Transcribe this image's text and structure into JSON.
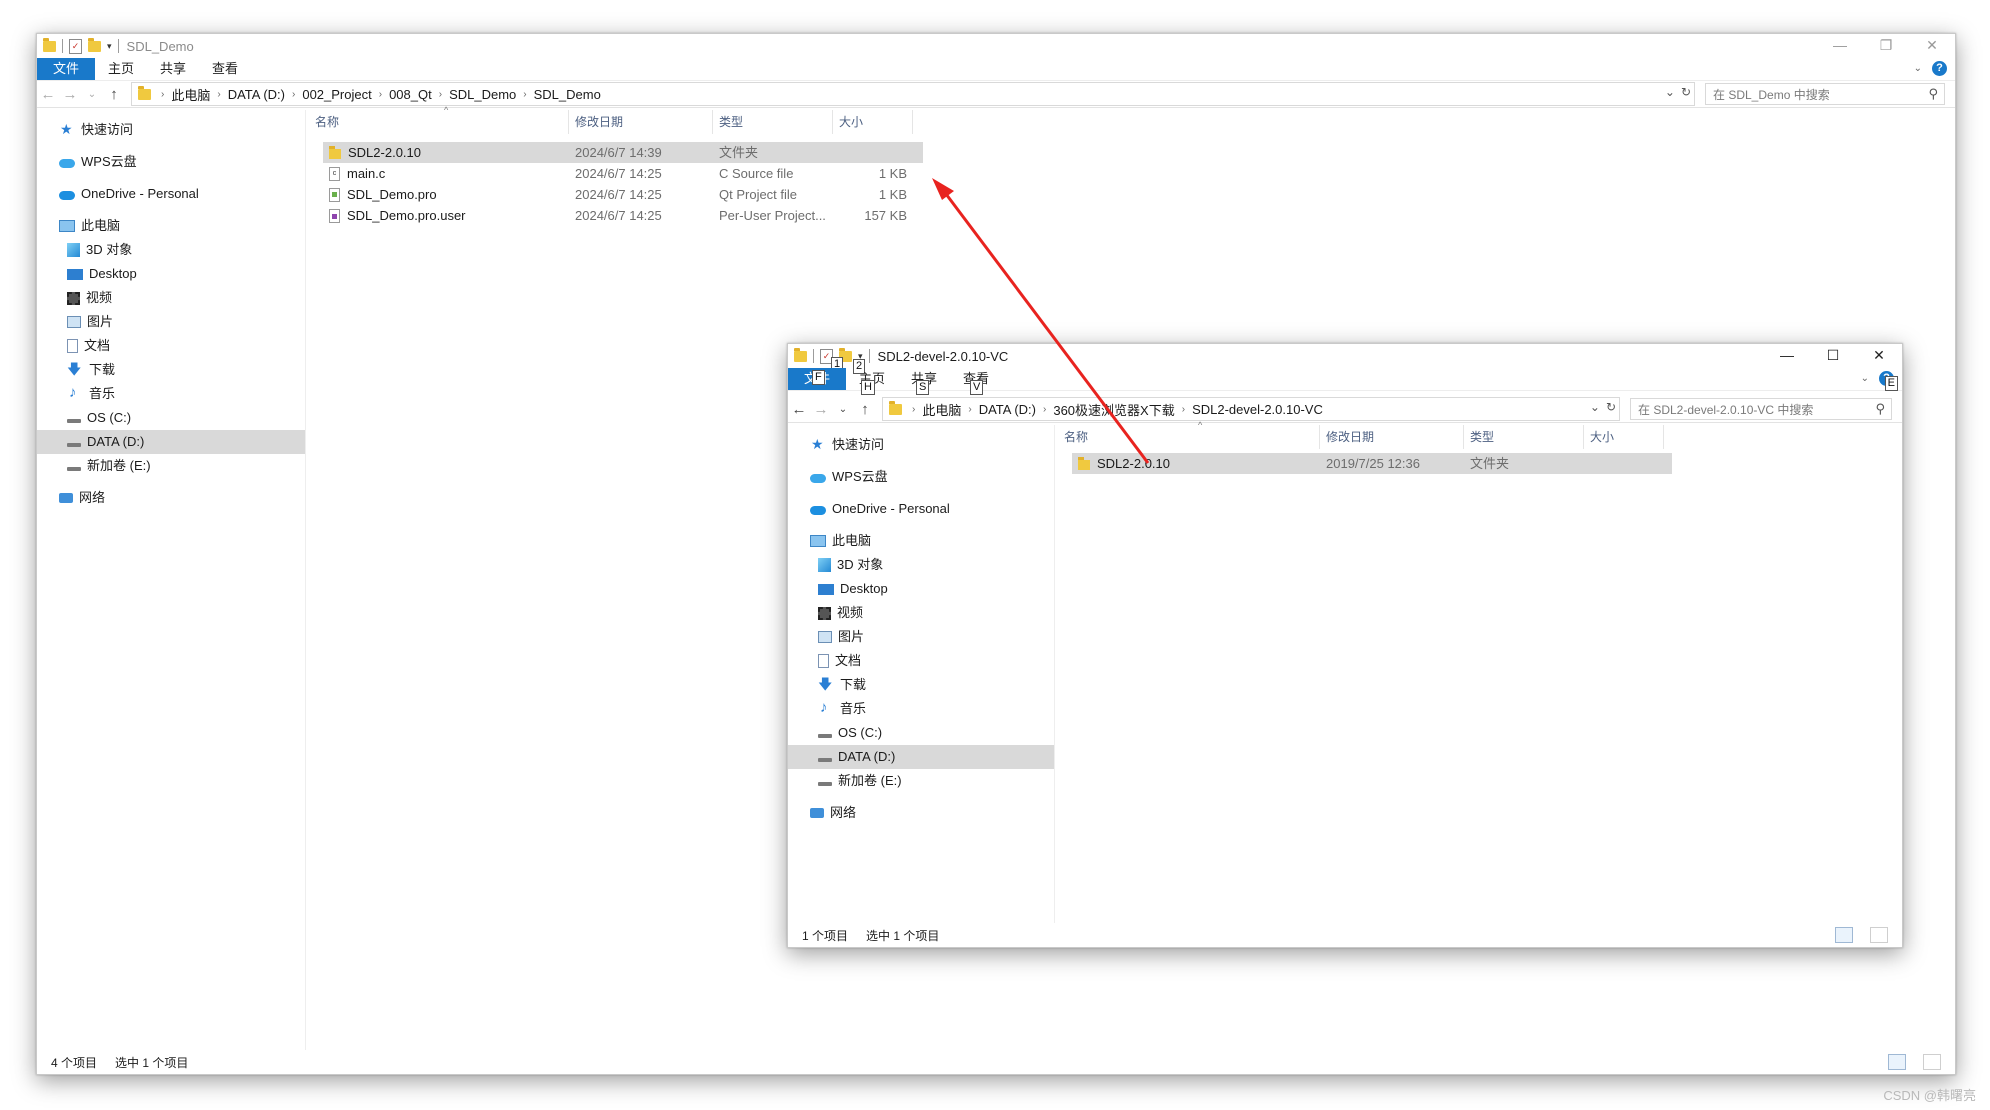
{
  "main_window": {
    "title": "SDL_Demo",
    "tabs": {
      "file": "文件",
      "home": "主页",
      "share": "共享",
      "view": "查看"
    },
    "breadcrumb": [
      "此电脑",
      "DATA (D:)",
      "002_Project",
      "008_Qt",
      "SDL_Demo",
      "SDL_Demo"
    ],
    "search_placeholder": "在 SDL_Demo 中搜索",
    "nav": {
      "quick_access": "快速访问",
      "wps": "WPS云盘",
      "onedrive": "OneDrive - Personal",
      "this_pc": "此电脑",
      "objects3d": "3D 对象",
      "desktop": "Desktop",
      "videos": "视频",
      "pictures": "图片",
      "documents": "文档",
      "downloads": "下载",
      "music": "音乐",
      "drive_c": "OS (C:)",
      "drive_d": "DATA (D:)",
      "drive_e": "新加卷 (E:)",
      "network": "网络"
    },
    "columns": {
      "name": "名称",
      "date": "修改日期",
      "type": "类型",
      "size": "大小"
    },
    "files": [
      {
        "name": "SDL2-2.0.10",
        "date": "2024/6/7 14:39",
        "type": "文件夹",
        "size": "",
        "icon": "folder-icon"
      },
      {
        "name": "main.c",
        "date": "2024/6/7 14:25",
        "type": "C Source file",
        "size": "1 KB",
        "icon": "c-source-file-icon"
      },
      {
        "name": "SDL_Demo.pro",
        "date": "2024/6/7 14:25",
        "type": "Qt Project file",
        "size": "1 KB",
        "icon": "qt-project-file-icon"
      },
      {
        "name": "SDL_Demo.pro.user",
        "date": "2024/6/7 14:25",
        "type": "Per-User Project...",
        "size": "157 KB",
        "icon": "user-project-file-icon"
      }
    ],
    "status": {
      "count": "4 个项目",
      "selected": "选中 1 个项目"
    }
  },
  "sub_window": {
    "title": "SDL2-devel-2.0.10-VC",
    "tabs": {
      "file": "文件",
      "home": "主页",
      "share": "共享",
      "view": "查看"
    },
    "keytips": {
      "qat1": "1",
      "qat2": "2",
      "file": "F",
      "home": "H",
      "share": "S",
      "view": "V",
      "help": "E"
    },
    "breadcrumb": [
      "此电脑",
      "DATA (D:)",
      "360极速浏览器X下载",
      "SDL2-devel-2.0.10-VC"
    ],
    "search_placeholder": "在 SDL2-devel-2.0.10-VC 中搜索",
    "nav": {
      "quick_access": "快速访问",
      "wps": "WPS云盘",
      "onedrive": "OneDrive - Personal",
      "this_pc": "此电脑",
      "objects3d": "3D 对象",
      "desktop": "Desktop",
      "videos": "视频",
      "pictures": "图片",
      "documents": "文档",
      "downloads": "下载",
      "music": "音乐",
      "drive_c": "OS (C:)",
      "drive_d": "DATA (D:)",
      "drive_e": "新加卷 (E:)",
      "network": "网络"
    },
    "columns": {
      "name": "名称",
      "date": "修改日期",
      "type": "类型",
      "size": "大小"
    },
    "files": [
      {
        "name": "SDL2-2.0.10",
        "date": "2019/7/25 12:36",
        "type": "文件夹",
        "size": "",
        "icon": "folder-icon"
      }
    ],
    "status": {
      "count": "1 个项目",
      "selected": "选中 1 个项目"
    }
  },
  "annotation": {
    "arrow_color": "#e8231f"
  },
  "watermark": "CSDN @韩曙亮",
  "colors": {
    "accent": "#1979ca",
    "selection": "#d9d9d9"
  }
}
